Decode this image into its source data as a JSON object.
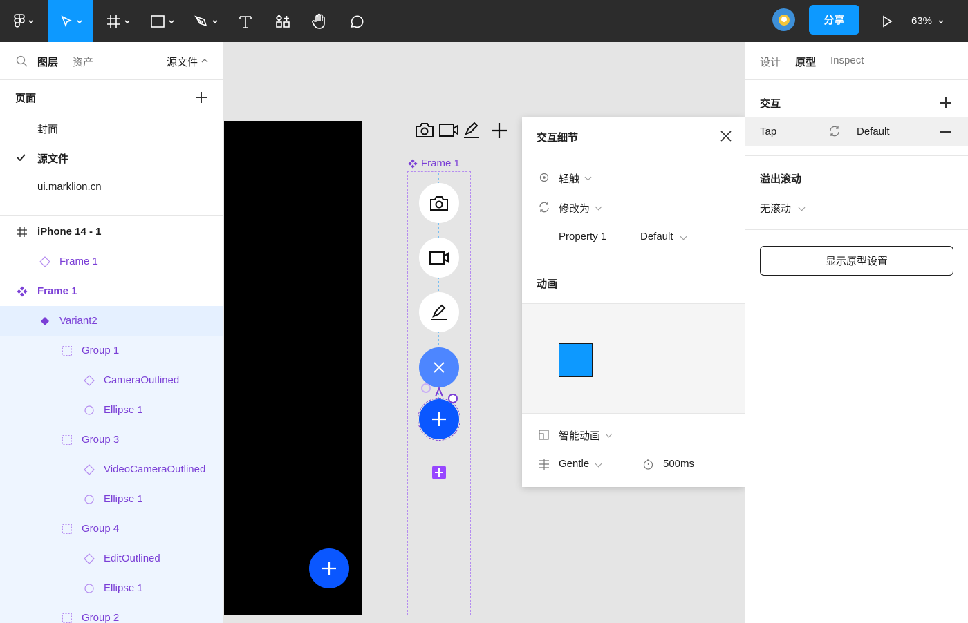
{
  "toolbar": {
    "share_label": "分享",
    "zoom_label": "63%"
  },
  "left_panel": {
    "tabs": {
      "layers": "图层",
      "assets": "资产",
      "source": "源文件"
    },
    "pages_title": "页面",
    "pages": [
      "封面",
      "源文件",
      "ui.marklion.cn"
    ],
    "layers": [
      {
        "label": "iPhone 14 - 1"
      },
      {
        "label": "Frame 1"
      },
      {
        "label": "Frame 1"
      },
      {
        "label": "Variant2"
      },
      {
        "label": "Group 1"
      },
      {
        "label": "CameraOutlined"
      },
      {
        "label": "Ellipse 1"
      },
      {
        "label": "Group 3"
      },
      {
        "label": "VideoCameraOutlined"
      },
      {
        "label": "Ellipse 1"
      },
      {
        "label": "Group 4"
      },
      {
        "label": "EditOutlined"
      },
      {
        "label": "Ellipse 1"
      },
      {
        "label": "Group 2"
      }
    ]
  },
  "canvas": {
    "frame_label": "Frame 1"
  },
  "popup": {
    "title": "交互细节",
    "trigger": "轻触",
    "action": "修改为",
    "property_name": "Property 1",
    "property_value": "Default",
    "animation_title": "动画",
    "animation_type": "智能动画",
    "easing": "Gentle",
    "duration": "500ms"
  },
  "right_panel": {
    "tabs": {
      "design": "设计",
      "prototype": "原型",
      "inspect": "Inspect"
    },
    "interactions_title": "交互",
    "interaction_trigger": "Tap",
    "interaction_target": "Default",
    "overflow_title": "溢出滚动",
    "overflow_value": "无滚动",
    "prototype_settings_button": "显示原型设置"
  },
  "colors": {
    "accent": "#0d99ff",
    "component_purple": "#7b3fd6",
    "fab_blue": "#0a57ff"
  }
}
